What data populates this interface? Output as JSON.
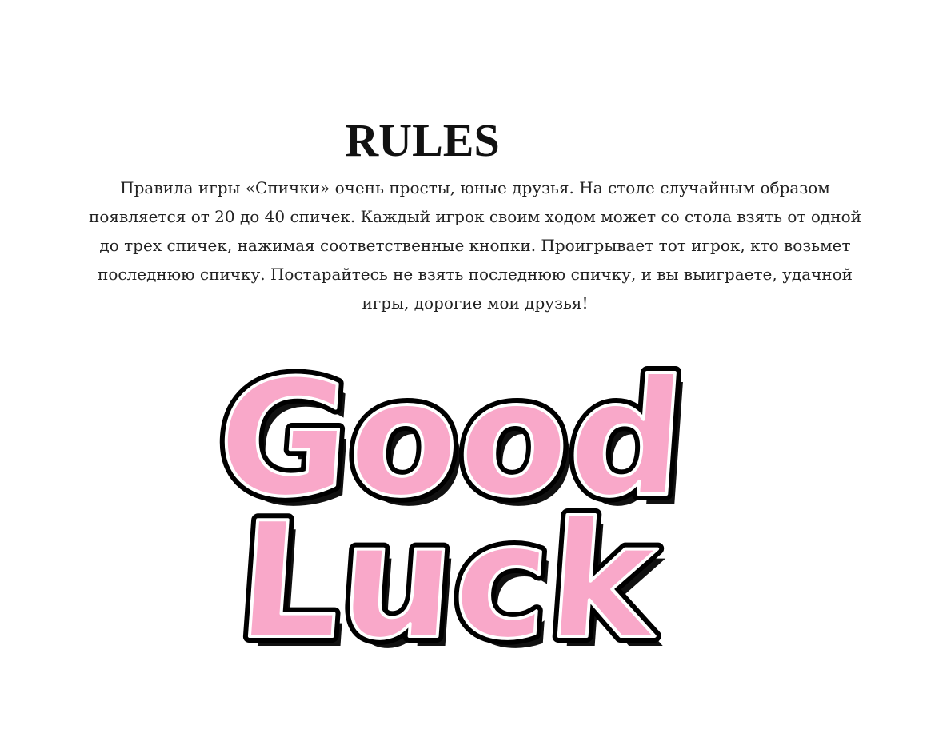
{
  "page": {
    "title": "RULES",
    "rules_text": "Правила игры «Спички» очень просты, юные друзья. На столе случайным образом появляется от 20 до 40 спичек. Каждый игрок своим ходом может со стола взять от одной до трех спичек, нажимая соответственные кнопки. Проигрывает тот игрок, кто возьмет последнюю спичку. Постарайтесь не взять последнюю спичку, и вы выиграете, удачной игры, дорогие мои друзья!"
  },
  "sticker": {
    "line1": "Good",
    "line2": "Luck",
    "fill_color": "#f9a8c9",
    "outline_color": "#000000",
    "shadow_color": "#111111"
  }
}
